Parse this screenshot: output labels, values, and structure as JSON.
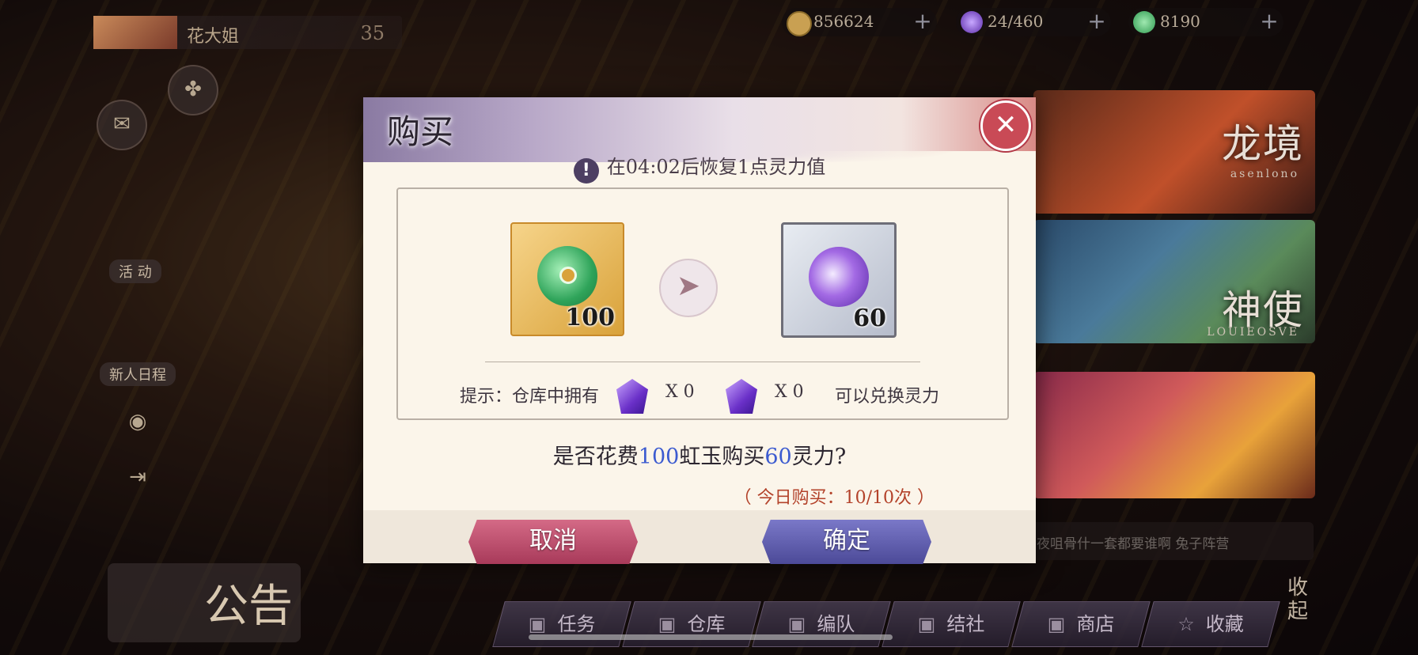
{
  "player": {
    "name": "花大姐",
    "level": "35"
  },
  "currencies": [
    {
      "icon": "coin-icon",
      "value": "856624",
      "color": "#c9a052"
    },
    {
      "icon": "spirit-flame-icon",
      "value": "24/460",
      "color": "#7a5ad0"
    },
    {
      "icon": "rainbow-jade-icon",
      "value": "8190",
      "color": "#3fae5e"
    }
  ],
  "side_menu": {
    "activity": "活 动",
    "newbie": "新人日程"
  },
  "banners": {
    "dragon": "龙境",
    "dragon_sub": "asenlono",
    "shrine": "神使",
    "shrine_sub": "LOUIEOSVE"
  },
  "chat": {
    "text": "夜咀骨什一套都要谁啊 兔子阵营"
  },
  "bottom_nav": [
    "任务",
    "仓库",
    "编队",
    "结社",
    "商店",
    "收藏"
  ],
  "collapse_label": "收起",
  "notice_label": "公告",
  "dialog": {
    "title": "购买",
    "info": "在04:02后恢复1点灵力值",
    "cost_qty": "100",
    "gain_qty": "60",
    "hint_prefix": "提示：仓库中拥有",
    "hint_x1": "X 0",
    "hint_x2": "X 0",
    "hint_suffix": "可以兑换灵力",
    "question_a": "是否花费",
    "question_num1": "100",
    "question_b": "虹玉购买",
    "question_num2": "60",
    "question_c": "灵力?",
    "today_limit": "（ 今日购买：10/10次 ）",
    "cancel": "取消",
    "confirm": "确定"
  }
}
